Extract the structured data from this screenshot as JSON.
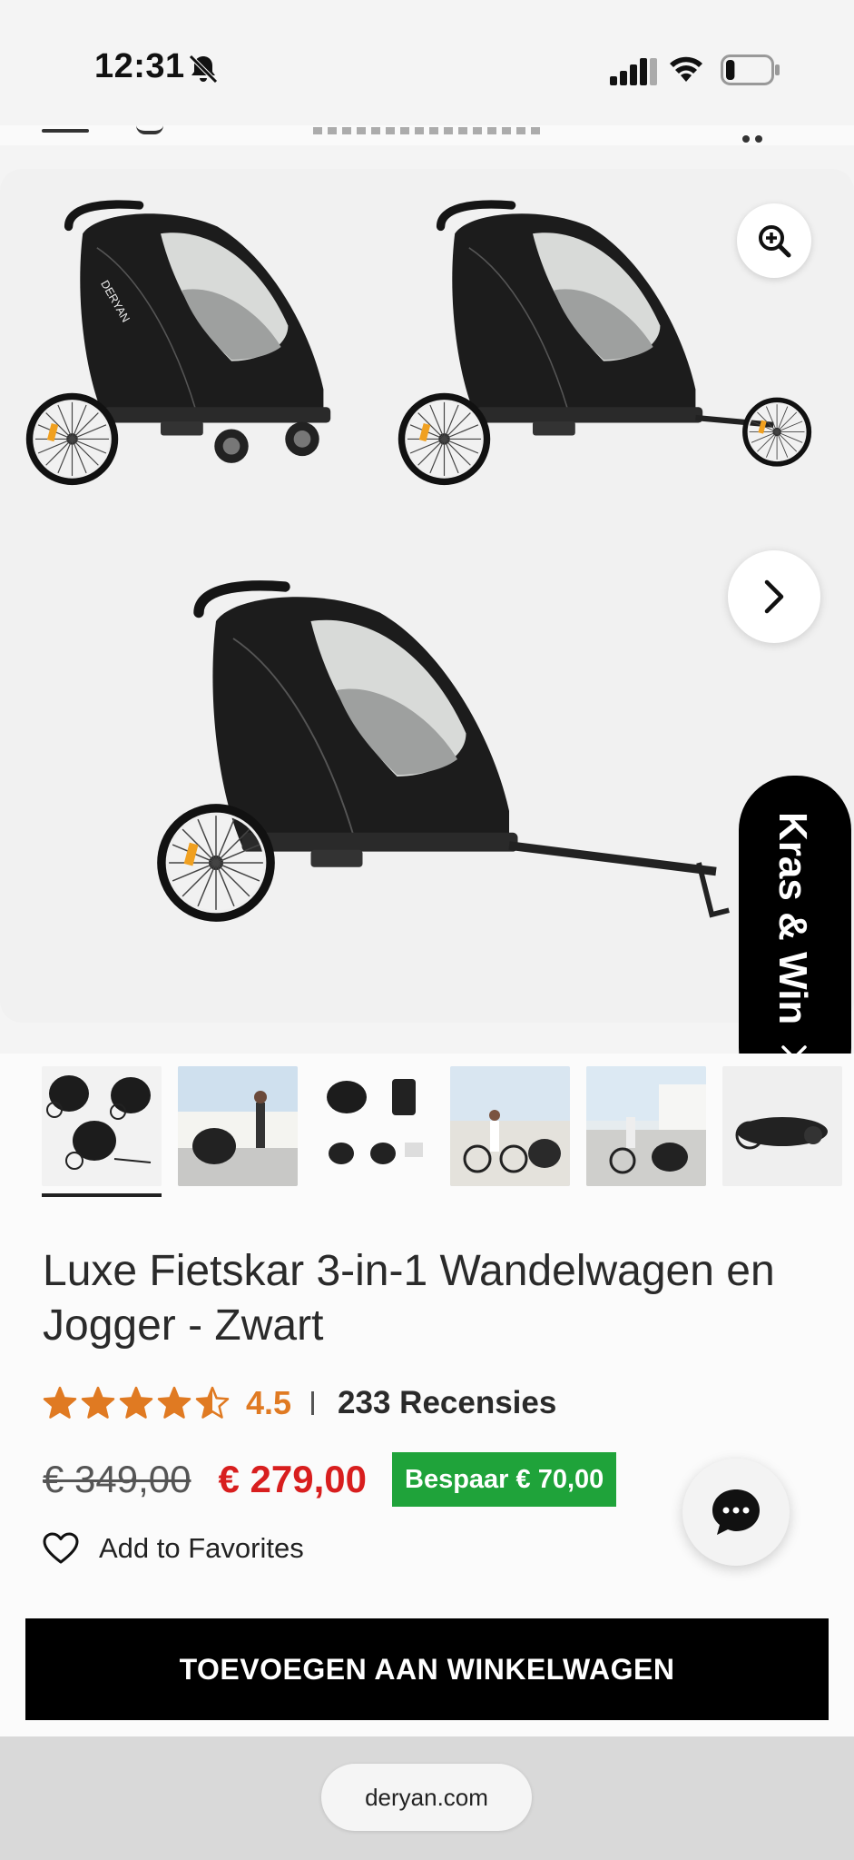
{
  "status_bar": {
    "time": "12:31",
    "battery_level": 0.2
  },
  "promo_tab": {
    "label": "Kras & Win"
  },
  "product": {
    "title": "Luxe Fietskar 3-in-1 Wandelwagen en Jogger - Zwart",
    "rating": 4.5,
    "rating_label": "4.5",
    "review_count_label": "233 Recensies",
    "price_old": "€ 349,00",
    "price_new": "€ 279,00",
    "save_badge": "Bespaar  € 70,00",
    "favorites_label": "Add to Favorites",
    "add_to_cart_label": "TOEVOEGEN AAN WINKELWAGEN"
  },
  "gallery": {
    "thumbnail_count": 6,
    "selected_thumbnail": 1,
    "product_logo_text": "DERYAN"
  },
  "browser": {
    "url": "deryan.com"
  },
  "colors": {
    "star": "#e07a22",
    "sale_price": "#d81e1e",
    "save_badge_bg": "#1fa33a",
    "cart_button_bg": "#000000"
  },
  "icons": [
    "bell-slash-icon",
    "signal-icon",
    "wifi-icon",
    "battery-icon",
    "zoom-in-icon",
    "chevron-right-icon",
    "close-icon",
    "star-icon",
    "heart-icon",
    "chat-icon"
  ]
}
